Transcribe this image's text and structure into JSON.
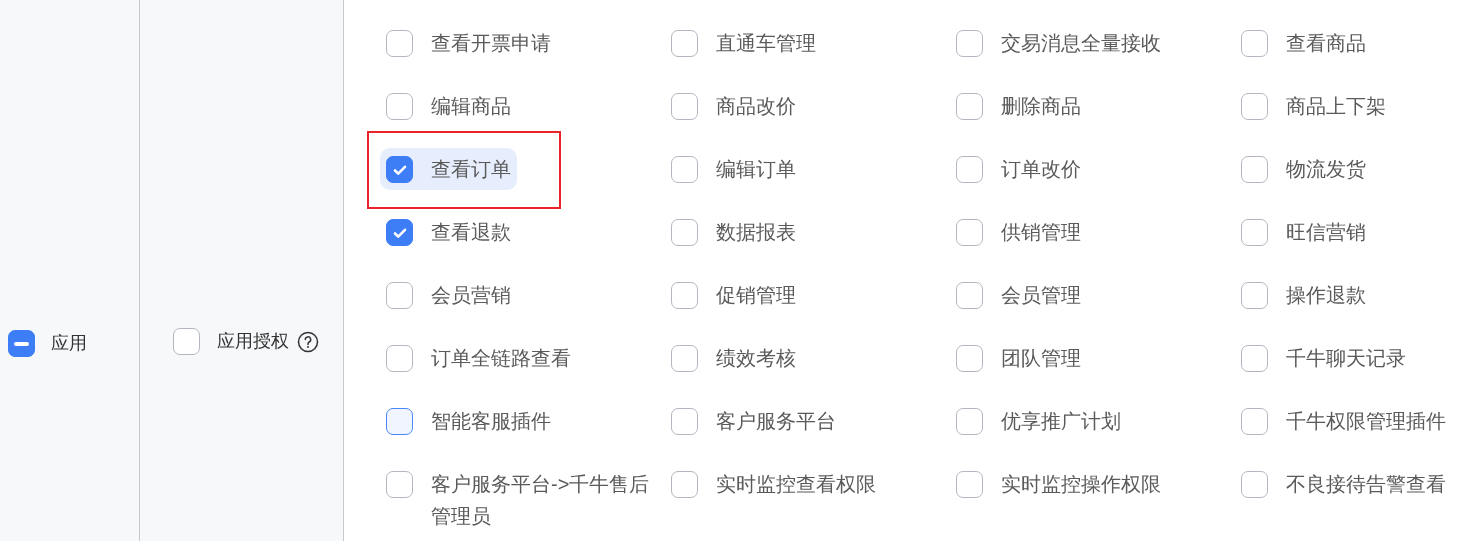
{
  "group": {
    "label": "应用",
    "indeterminate": true
  },
  "subgroup": {
    "label": "应用授权",
    "checked": false
  },
  "permissions": [
    {
      "label": "查看开票申请",
      "checked": false,
      "highlighted": false,
      "focused": false,
      "annotated": false
    },
    {
      "label": "直通车管理",
      "checked": false,
      "highlighted": false,
      "focused": false,
      "annotated": false
    },
    {
      "label": "交易消息全量接收",
      "checked": false,
      "highlighted": false,
      "focused": false,
      "annotated": false
    },
    {
      "label": "查看商品",
      "checked": false,
      "highlighted": false,
      "focused": false,
      "annotated": false
    },
    {
      "label": "编辑商品",
      "checked": false,
      "highlighted": false,
      "focused": false,
      "annotated": false
    },
    {
      "label": "商品改价",
      "checked": false,
      "highlighted": false,
      "focused": false,
      "annotated": false
    },
    {
      "label": "删除商品",
      "checked": false,
      "highlighted": false,
      "focused": false,
      "annotated": false
    },
    {
      "label": "商品上下架",
      "checked": false,
      "highlighted": false,
      "focused": false,
      "annotated": false
    },
    {
      "label": "查看订单",
      "checked": true,
      "highlighted": true,
      "focused": false,
      "annotated": true
    },
    {
      "label": "编辑订单",
      "checked": false,
      "highlighted": false,
      "focused": false,
      "annotated": false
    },
    {
      "label": "订单改价",
      "checked": false,
      "highlighted": false,
      "focused": false,
      "annotated": false
    },
    {
      "label": "物流发货",
      "checked": false,
      "highlighted": false,
      "focused": false,
      "annotated": false
    },
    {
      "label": "查看退款",
      "checked": true,
      "highlighted": false,
      "focused": false,
      "annotated": false
    },
    {
      "label": "数据报表",
      "checked": false,
      "highlighted": false,
      "focused": false,
      "annotated": false
    },
    {
      "label": "供销管理",
      "checked": false,
      "highlighted": false,
      "focused": false,
      "annotated": false
    },
    {
      "label": "旺信营销",
      "checked": false,
      "highlighted": false,
      "focused": false,
      "annotated": false
    },
    {
      "label": "会员营销",
      "checked": false,
      "highlighted": false,
      "focused": false,
      "annotated": false
    },
    {
      "label": "促销管理",
      "checked": false,
      "highlighted": false,
      "focused": false,
      "annotated": false
    },
    {
      "label": "会员管理",
      "checked": false,
      "highlighted": false,
      "focused": false,
      "annotated": false
    },
    {
      "label": "操作退款",
      "checked": false,
      "highlighted": false,
      "focused": false,
      "annotated": false
    },
    {
      "label": "订单全链路查看",
      "checked": false,
      "highlighted": false,
      "focused": false,
      "annotated": false
    },
    {
      "label": "绩效考核",
      "checked": false,
      "highlighted": false,
      "focused": false,
      "annotated": false
    },
    {
      "label": "团队管理",
      "checked": false,
      "highlighted": false,
      "focused": false,
      "annotated": false
    },
    {
      "label": "千牛聊天记录",
      "checked": false,
      "highlighted": false,
      "focused": false,
      "annotated": false
    },
    {
      "label": "智能客服插件",
      "checked": false,
      "highlighted": false,
      "focused": true,
      "annotated": false
    },
    {
      "label": "客户服务平台",
      "checked": false,
      "highlighted": false,
      "focused": false,
      "annotated": false
    },
    {
      "label": "优享推广计划",
      "checked": false,
      "highlighted": false,
      "focused": false,
      "annotated": false
    },
    {
      "label": "千牛权限管理插件",
      "checked": false,
      "highlighted": false,
      "focused": false,
      "annotated": false
    },
    {
      "label": "客户服务平台->千牛售后管理员",
      "checked": false,
      "highlighted": false,
      "focused": false,
      "annotated": false
    },
    {
      "label": "实时监控查看权限",
      "checked": false,
      "highlighted": false,
      "focused": false,
      "annotated": false
    },
    {
      "label": "实时监控操作权限",
      "checked": false,
      "highlighted": false,
      "focused": false,
      "annotated": false
    },
    {
      "label": "不良接待告警查看",
      "checked": false,
      "highlighted": false,
      "focused": false,
      "annotated": false
    }
  ]
}
